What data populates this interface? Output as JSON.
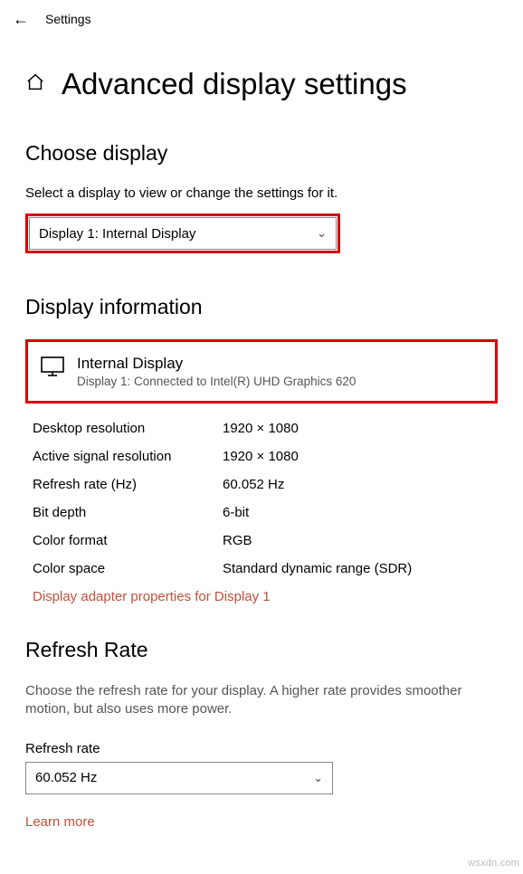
{
  "topbar": {
    "settings_label": "Settings"
  },
  "title": "Advanced display settings",
  "choose_display": {
    "heading": "Choose display",
    "subtext": "Select a display to view or change the settings for it.",
    "selected": "Display 1: Internal Display"
  },
  "display_info": {
    "heading": "Display information",
    "card_title": "Internal Display",
    "card_sub": "Display 1: Connected to Intel(R) UHD Graphics 620",
    "rows": [
      {
        "key": "Desktop resolution",
        "val": "1920 × 1080"
      },
      {
        "key": "Active signal resolution",
        "val": "1920 × 1080"
      },
      {
        "key": "Refresh rate (Hz)",
        "val": "60.052 Hz"
      },
      {
        "key": "Bit depth",
        "val": "6-bit"
      },
      {
        "key": "Color format",
        "val": "RGB"
      },
      {
        "key": "Color space",
        "val": "Standard dynamic range (SDR)"
      }
    ],
    "adapter_link": "Display adapter properties for Display 1"
  },
  "refresh_rate": {
    "heading": "Refresh Rate",
    "desc": "Choose the refresh rate for your display. A higher rate provides smoother motion, but also uses more power.",
    "field_label": "Refresh rate",
    "selected": "60.052 Hz",
    "learn_more": "Learn more"
  },
  "watermark": "wsxdn.com"
}
